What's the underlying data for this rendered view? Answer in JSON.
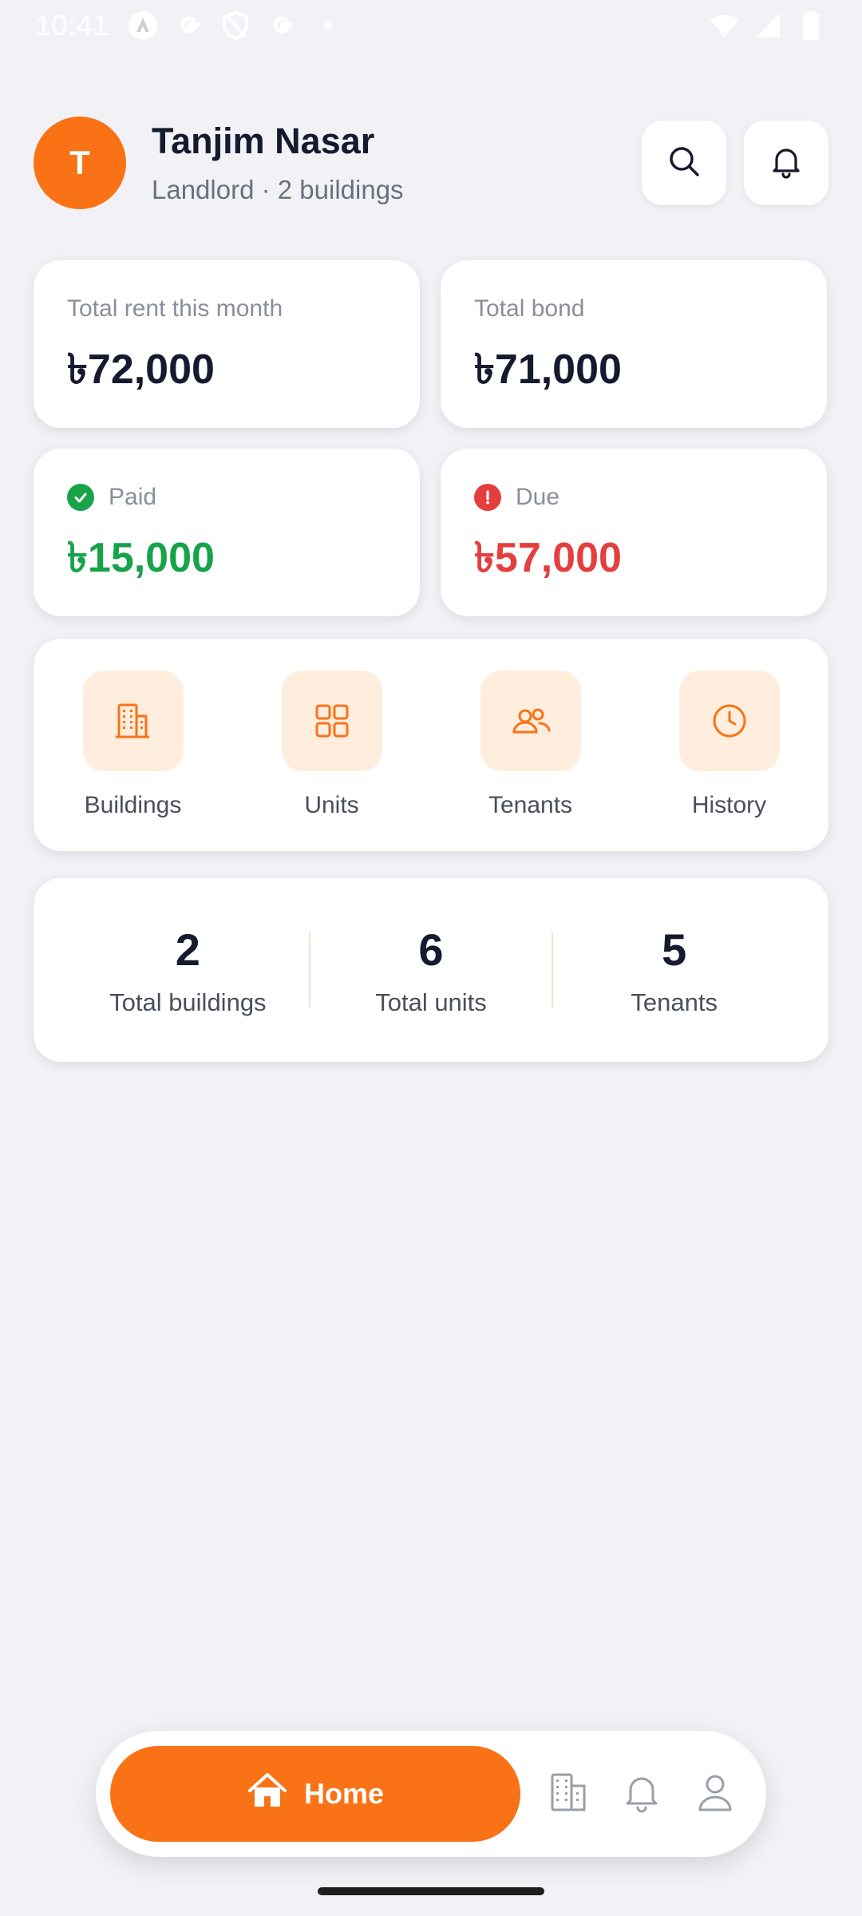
{
  "status_bar": {
    "time": "10:41"
  },
  "header": {
    "avatar_initial": "T",
    "name": "Tanjim Nasar",
    "subtitle": "Landlord · 2 buildings",
    "icons": [
      "search-icon",
      "bell-icon"
    ]
  },
  "stats": {
    "total_rent": {
      "label": "Total rent this month",
      "value": "৳72,000"
    },
    "total_bond": {
      "label": "Total bond",
      "value": "৳71,000"
    },
    "paid": {
      "label": "Paid",
      "value": "৳15,000",
      "color": "#16a34a"
    },
    "due": {
      "label": "Due",
      "value": "৳57,000",
      "color": "#e53e3e"
    }
  },
  "quick_actions": [
    {
      "label": "Buildings",
      "icon": "building-icon"
    },
    {
      "label": "Units",
      "icon": "grid-icon"
    },
    {
      "label": "Tenants",
      "icon": "users-icon"
    },
    {
      "label": "History",
      "icon": "clock-icon"
    }
  ],
  "summary": [
    {
      "value": "2",
      "label": "Total buildings"
    },
    {
      "value": "6",
      "label": "Total units"
    },
    {
      "value": "5",
      "label": "Tenants"
    }
  ],
  "bottom_nav": {
    "active": {
      "label": "Home",
      "icon": "home-icon"
    },
    "items": [
      "building-icon",
      "bell-icon",
      "user-icon"
    ]
  },
  "colors": {
    "accent": "#f97316",
    "accent_soft": "#ffedde",
    "background": "#f2f2f6"
  }
}
